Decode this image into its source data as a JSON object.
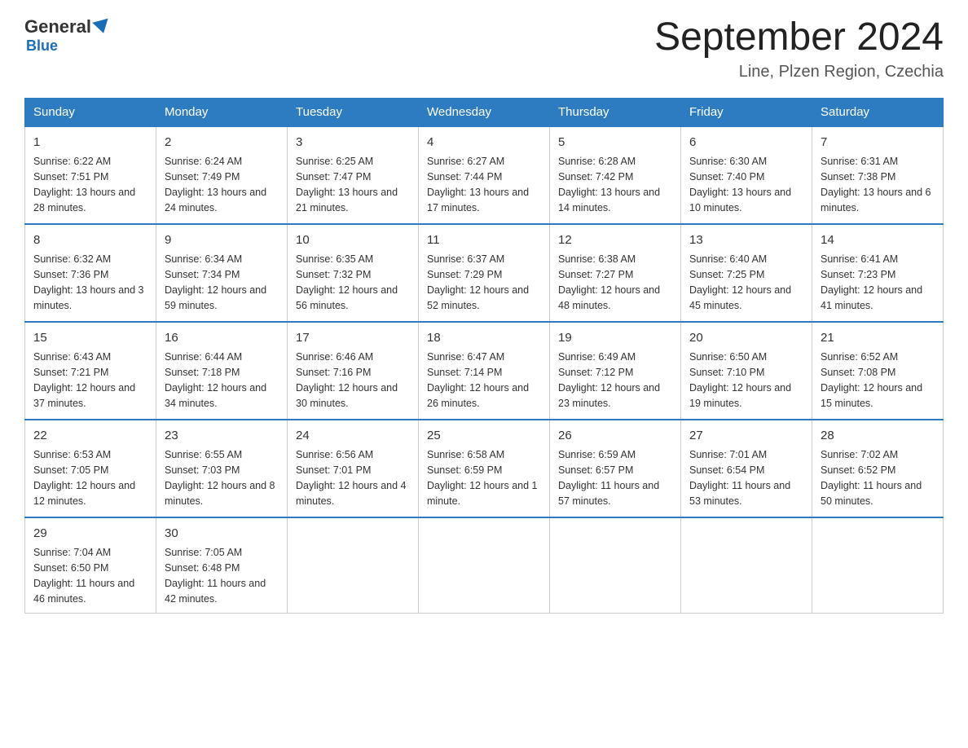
{
  "header": {
    "logo_general": "General",
    "logo_blue": "Blue",
    "month_title": "September 2024",
    "location": "Line, Plzen Region, Czechia"
  },
  "days_of_week": [
    "Sunday",
    "Monday",
    "Tuesday",
    "Wednesday",
    "Thursday",
    "Friday",
    "Saturday"
  ],
  "weeks": [
    [
      {
        "day": 1,
        "sunrise": "6:22 AM",
        "sunset": "7:51 PM",
        "daylight": "13 hours and 28 minutes."
      },
      {
        "day": 2,
        "sunrise": "6:24 AM",
        "sunset": "7:49 PM",
        "daylight": "13 hours and 24 minutes."
      },
      {
        "day": 3,
        "sunrise": "6:25 AM",
        "sunset": "7:47 PM",
        "daylight": "13 hours and 21 minutes."
      },
      {
        "day": 4,
        "sunrise": "6:27 AM",
        "sunset": "7:44 PM",
        "daylight": "13 hours and 17 minutes."
      },
      {
        "day": 5,
        "sunrise": "6:28 AM",
        "sunset": "7:42 PM",
        "daylight": "13 hours and 14 minutes."
      },
      {
        "day": 6,
        "sunrise": "6:30 AM",
        "sunset": "7:40 PM",
        "daylight": "13 hours and 10 minutes."
      },
      {
        "day": 7,
        "sunrise": "6:31 AM",
        "sunset": "7:38 PM",
        "daylight": "13 hours and 6 minutes."
      }
    ],
    [
      {
        "day": 8,
        "sunrise": "6:32 AM",
        "sunset": "7:36 PM",
        "daylight": "13 hours and 3 minutes."
      },
      {
        "day": 9,
        "sunrise": "6:34 AM",
        "sunset": "7:34 PM",
        "daylight": "12 hours and 59 minutes."
      },
      {
        "day": 10,
        "sunrise": "6:35 AM",
        "sunset": "7:32 PM",
        "daylight": "12 hours and 56 minutes."
      },
      {
        "day": 11,
        "sunrise": "6:37 AM",
        "sunset": "7:29 PM",
        "daylight": "12 hours and 52 minutes."
      },
      {
        "day": 12,
        "sunrise": "6:38 AM",
        "sunset": "7:27 PM",
        "daylight": "12 hours and 48 minutes."
      },
      {
        "day": 13,
        "sunrise": "6:40 AM",
        "sunset": "7:25 PM",
        "daylight": "12 hours and 45 minutes."
      },
      {
        "day": 14,
        "sunrise": "6:41 AM",
        "sunset": "7:23 PM",
        "daylight": "12 hours and 41 minutes."
      }
    ],
    [
      {
        "day": 15,
        "sunrise": "6:43 AM",
        "sunset": "7:21 PM",
        "daylight": "12 hours and 37 minutes."
      },
      {
        "day": 16,
        "sunrise": "6:44 AM",
        "sunset": "7:18 PM",
        "daylight": "12 hours and 34 minutes."
      },
      {
        "day": 17,
        "sunrise": "6:46 AM",
        "sunset": "7:16 PM",
        "daylight": "12 hours and 30 minutes."
      },
      {
        "day": 18,
        "sunrise": "6:47 AM",
        "sunset": "7:14 PM",
        "daylight": "12 hours and 26 minutes."
      },
      {
        "day": 19,
        "sunrise": "6:49 AM",
        "sunset": "7:12 PM",
        "daylight": "12 hours and 23 minutes."
      },
      {
        "day": 20,
        "sunrise": "6:50 AM",
        "sunset": "7:10 PM",
        "daylight": "12 hours and 19 minutes."
      },
      {
        "day": 21,
        "sunrise": "6:52 AM",
        "sunset": "7:08 PM",
        "daylight": "12 hours and 15 minutes."
      }
    ],
    [
      {
        "day": 22,
        "sunrise": "6:53 AM",
        "sunset": "7:05 PM",
        "daylight": "12 hours and 12 minutes."
      },
      {
        "day": 23,
        "sunrise": "6:55 AM",
        "sunset": "7:03 PM",
        "daylight": "12 hours and 8 minutes."
      },
      {
        "day": 24,
        "sunrise": "6:56 AM",
        "sunset": "7:01 PM",
        "daylight": "12 hours and 4 minutes."
      },
      {
        "day": 25,
        "sunrise": "6:58 AM",
        "sunset": "6:59 PM",
        "daylight": "12 hours and 1 minute."
      },
      {
        "day": 26,
        "sunrise": "6:59 AM",
        "sunset": "6:57 PM",
        "daylight": "11 hours and 57 minutes."
      },
      {
        "day": 27,
        "sunrise": "7:01 AM",
        "sunset": "6:54 PM",
        "daylight": "11 hours and 53 minutes."
      },
      {
        "day": 28,
        "sunrise": "7:02 AM",
        "sunset": "6:52 PM",
        "daylight": "11 hours and 50 minutes."
      }
    ],
    [
      {
        "day": 29,
        "sunrise": "7:04 AM",
        "sunset": "6:50 PM",
        "daylight": "11 hours and 46 minutes."
      },
      {
        "day": 30,
        "sunrise": "7:05 AM",
        "sunset": "6:48 PM",
        "daylight": "11 hours and 42 minutes."
      },
      null,
      null,
      null,
      null,
      null
    ]
  ]
}
